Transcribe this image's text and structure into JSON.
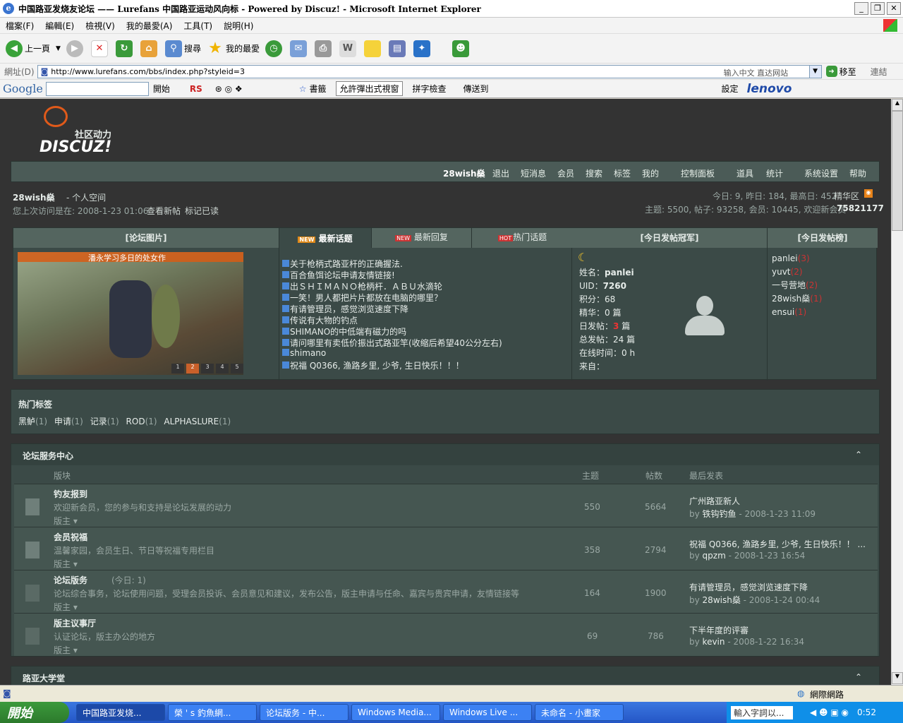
{
  "window": {
    "title": "中国路亚发烧友论坛 —— Lurefans 中国路亚运动风向标 - Powered by Discuz! - Microsoft Internet Explorer"
  },
  "menu": [
    "檔案(F)",
    "編輯(E)",
    "檢視(V)",
    "我的最愛(A)",
    "工具(T)",
    "說明(H)"
  ],
  "toolbar": {
    "back": "上一頁",
    "search": "搜尋",
    "favorites": "我的最愛"
  },
  "address": {
    "label": "網址(D)",
    "url": "http://www.lurefans.com/bbs/index.php?styleid=3",
    "hint": "输入中文 直达网站",
    "go": "移至",
    "links": "連結"
  },
  "googlebar": {
    "start": "開始",
    "rs": "RS",
    "bookmarks": "書籤",
    "popup": "允許彈出式視窗",
    "spell": "拼字檢查",
    "send": "傳送到",
    "settings": "設定",
    "brand": "lenovo"
  },
  "forum": {
    "logo_sub": "社区动力",
    "logo_main": "DISCUZ!",
    "nav": [
      "28wish燊",
      "退出",
      "短消息",
      "会员",
      "搜索",
      "标签",
      "我的",
      "控制面板",
      "道具",
      "统计",
      "系统设置",
      "帮助"
    ],
    "user": {
      "name": "28wish燊",
      "space": "- 个人空间",
      "last": "您上次访问是在: 2008-1-23 01:06",
      "newposts": "查看新帖",
      "markread": "标记已读"
    },
    "stats": {
      "line1": "今日: 9, 昨日: 184, 最高日: 452",
      "elite": "精华区",
      "line2": "主题: 5500, 帖子: 93258, 会员: 10445, 欢迎新会员",
      "newmember": "75821177"
    },
    "pics": {
      "header": "[论坛图片]",
      "caption": "潘永学习多日的处女作",
      "pages": [
        "1",
        "2",
        "3",
        "4",
        "5"
      ]
    },
    "tabs": {
      "new": "最新话题",
      "reply": "最新回复",
      "hot": "热门话题",
      "badge_new": "NEW",
      "badge_hot": "HOT"
    },
    "topics": [
      "关于枪柄式路亚杆的正确握法.",
      "百合鱼饵论坛申请友情链接!",
      "出ＳＨＩＭＡＮＯ枪柄杆．ＡＢＵ水滴轮",
      "一笑！男人都把片片都放在电脑的哪里？",
      "有请管理员，感觉浏览速度下降",
      "传说有大物的钓点",
      "SHIMANO的中低端有磁力的吗",
      "请问哪里有卖低价振出式路亚竿(收缩后希望40公分左右)",
      "shimano",
      "祝福 Q0366, 渔路乡里, 少爷, 生日快乐！！！"
    ],
    "champ": {
      "header": "[今日发帖冠军]",
      "name_label": "姓名：",
      "name": "panlei",
      "uid_label": "UID：",
      "uid": "7260",
      "points": "积分：68",
      "elite": "精华：0 篇",
      "day_label": "日发帖：",
      "day": "3",
      "day_unit": "篇",
      "total": "总发帖：24 篇",
      "online": "在线时间：0 h",
      "from": "来自："
    },
    "rank": {
      "header": "[今日发帖榜]",
      "items": [
        {
          "n": "panlei",
          "c": "(3)"
        },
        {
          "n": "yuvt",
          "c": "(2)"
        },
        {
          "n": "一号营地",
          "c": "(2)"
        },
        {
          "n": "28wish燊",
          "c": "(1)"
        },
        {
          "n": "ensui",
          "c": "(1)"
        }
      ]
    },
    "tags": {
      "title": "热门标签",
      "items": [
        {
          "t": "黑鲈",
          "c": "(1)"
        },
        {
          "t": "申请",
          "c": "(1)"
        },
        {
          "t": "记录",
          "c": "(1)"
        },
        {
          "t": "ROD",
          "c": "(1)"
        },
        {
          "t": "ALPHASLURE",
          "c": "(1)"
        }
      ]
    },
    "section": {
      "title": "论坛服务中心",
      "cols": [
        "版块",
        "主题",
        "帖数",
        "最后发表"
      ],
      "boards": [
        {
          "name": "钓友报到",
          "today": "",
          "desc": "欢迎新会员，您的参与和支持是论坛发展的动力",
          "mods": "版主",
          "topics": "550",
          "posts": "5664",
          "last": "广州路亚新人",
          "by": "by",
          "user": "铁钩钓鱼",
          "date": " - 2008-1-23 11:09"
        },
        {
          "name": "会员祝福",
          "today": "",
          "desc": "温馨家园，会员生日、节日等祝福专用栏目",
          "mods": "版主",
          "topics": "358",
          "posts": "2794",
          "last": "祝福 Q0366, 渔路乡里, 少爷, 生日快乐！！ ...",
          "by": "by",
          "user": "qpzm",
          "date": " - 2008-1-23 16:54"
        },
        {
          "name": "论坛版务",
          "today": "(今日: 1)",
          "desc": "论坛综合事务，论坛使用问题，受理会员投诉、会员意见和建议，发布公告，版主申请与任命、嘉宾与贵宾申请，友情链接等",
          "mods": "版主",
          "topics": "164",
          "posts": "1900",
          "last": "有请管理员，感觉浏览速度下降",
          "by": "by",
          "user": "28wish燊",
          "date": " - 2008-1-24 00:44"
        },
        {
          "name": "版主议事厅",
          "today": "",
          "desc": "认证论坛，版主办公的地方",
          "mods": "版主",
          "topics": "69",
          "posts": "786",
          "last": "下半年度的评審",
          "by": "by",
          "user": "kevin",
          "date": " - 2008-1-22 16:34"
        }
      ]
    },
    "section2": "路亚大学堂"
  },
  "status": {
    "zone": "網際網路"
  },
  "taskbar": {
    "start": "開始",
    "items": [
      "中国路亚发烧...",
      "榮 ' s 釣魚網...",
      "论坛版务 - 中...",
      "Windows Media...",
      "Windows Live ...",
      "未命名 - 小畫家"
    ],
    "input": "輸入字詞以...",
    "clock": "0:52"
  }
}
